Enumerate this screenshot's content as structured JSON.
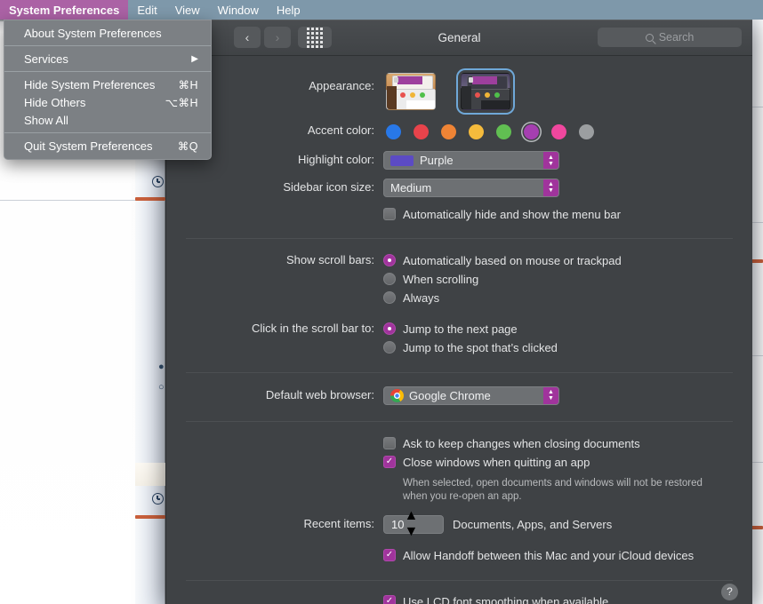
{
  "menubar": {
    "items": [
      {
        "label": "System Preferences",
        "active": true,
        "app": true
      },
      {
        "label": "Edit",
        "active": false
      },
      {
        "label": "View",
        "active": false
      },
      {
        "label": "Window",
        "active": false
      },
      {
        "label": "Help",
        "active": false
      }
    ],
    "highlight_color": "#ab62a5",
    "bar_color": "#7e98aa"
  },
  "dropdown": {
    "groups": [
      [
        {
          "label": "About System Preferences",
          "shortcut": ""
        }
      ],
      [
        {
          "label": "Services",
          "shortcut": "",
          "submenu": true
        }
      ],
      [
        {
          "label": "Hide System Preferences",
          "shortcut": "⌘H"
        },
        {
          "label": "Hide Others",
          "shortcut": "⌥⌘H"
        },
        {
          "label": "Show All",
          "shortcut": ""
        }
      ],
      [
        {
          "label": "Quit System Preferences",
          "shortcut": "⌘Q"
        }
      ]
    ]
  },
  "window": {
    "title": "General",
    "search_placeholder": "Search",
    "back_label": "‹",
    "forward_label": "›",
    "grid_label": "Show All"
  },
  "general": {
    "appearance": {
      "label": "Appearance:",
      "options": [
        {
          "name": "Light",
          "selected": false
        },
        {
          "name": "Dark",
          "selected": true
        }
      ]
    },
    "accent_color": {
      "label": "Accent color:",
      "swatches": [
        {
          "name": "Blue",
          "hex": "#2878e8",
          "selected": false
        },
        {
          "name": "Red",
          "hex": "#e8434b",
          "selected": false
        },
        {
          "name": "Orange",
          "hex": "#ef8435",
          "selected": false
        },
        {
          "name": "Yellow",
          "hex": "#f5bb3c",
          "selected": false
        },
        {
          "name": "Green",
          "hex": "#61bf52",
          "selected": false
        },
        {
          "name": "Purple",
          "hex": "#a53fb0",
          "selected": true
        },
        {
          "name": "Pink",
          "hex": "#f0479e",
          "selected": false
        },
        {
          "name": "Graphite",
          "hex": "#9b9ea0",
          "selected": false
        }
      ]
    },
    "highlight_color": {
      "label": "Highlight color:",
      "value": "Purple",
      "chip_hex": "#5c4bc4"
    },
    "sidebar_icon_size": {
      "label": "Sidebar icon size:",
      "value": "Medium"
    },
    "auto_hide_menu_bar": {
      "label": "Automatically hide and show the menu bar",
      "checked": false
    },
    "show_scroll_bars": {
      "label": "Show scroll bars:",
      "options": [
        {
          "label": "Automatically based on mouse or trackpad",
          "selected": true
        },
        {
          "label": "When scrolling",
          "selected": false
        },
        {
          "label": "Always",
          "selected": false
        }
      ]
    },
    "click_scroll_bar": {
      "label": "Click in the scroll bar to:",
      "options": [
        {
          "label": "Jump to the next page",
          "selected": true
        },
        {
          "label": "Jump to the spot that’s clicked",
          "selected": false
        }
      ]
    },
    "default_web_browser": {
      "label": "Default web browser:",
      "value": "Google Chrome"
    },
    "ask_keep_changes": {
      "label": "Ask to keep changes when closing documents",
      "checked": false
    },
    "close_windows_quitting": {
      "label": "Close windows when quitting an app",
      "checked": true
    },
    "close_windows_hint_line1": "When selected, open documents and windows will not be restored",
    "close_windows_hint_line2": "when you re-open an app.",
    "recent_items": {
      "label": "Recent items:",
      "value": "10",
      "suffix": "Documents, Apps, and Servers"
    },
    "allow_handoff": {
      "label": "Allow Handoff between this Mac and your iCloud devices",
      "checked": true
    },
    "lcd_font_smoothing": {
      "label": "Use LCD font smoothing when available",
      "checked": true
    },
    "help_label": "?"
  }
}
